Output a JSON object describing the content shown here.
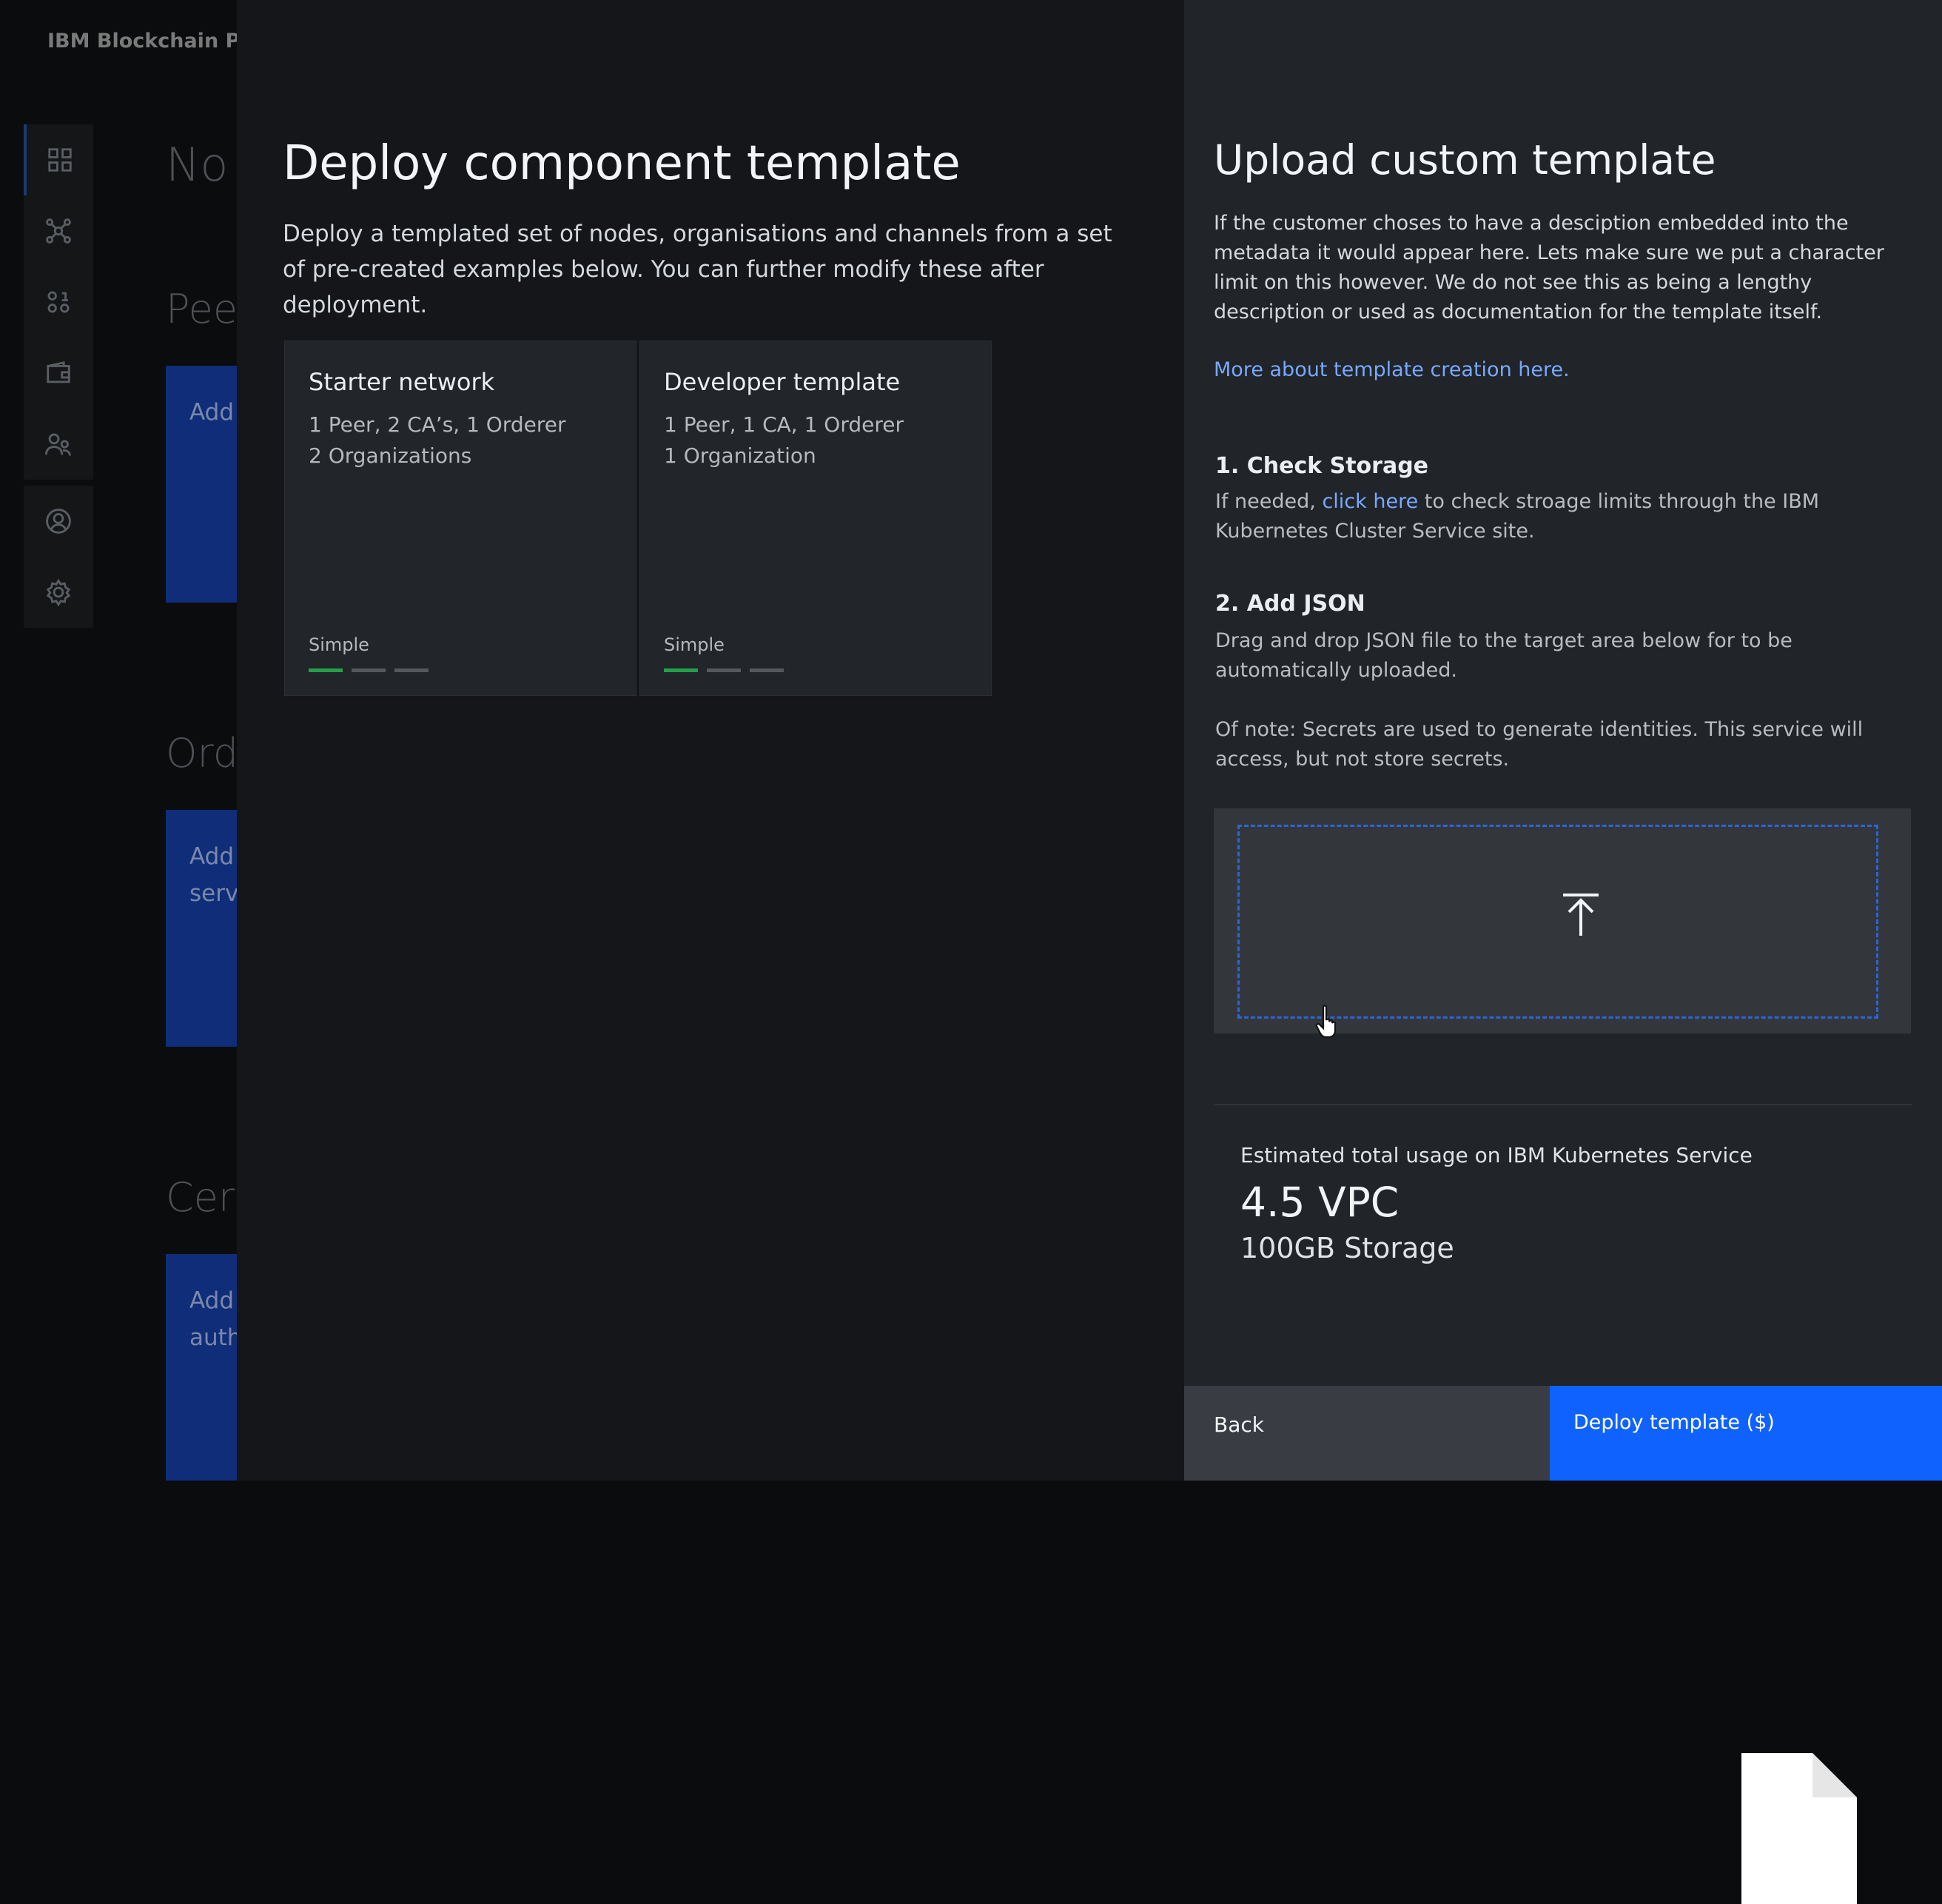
{
  "background": {
    "app_title": "IBM Blockchain Pla",
    "headings": {
      "nodes": "No",
      "peers": "Pee",
      "orderers": "Ord",
      "cas": "Cert"
    },
    "cards": {
      "peers": "Add",
      "orderers": "Add\nservi",
      "cas": "Add\nauth"
    },
    "nav_icons": [
      "grid-icon",
      "network-icon",
      "channels-icon",
      "wallet-icon",
      "organizations-icon",
      "user-profile-icon",
      "settings-icon"
    ]
  },
  "deploy_panel": {
    "title": "Deploy component template",
    "description": "Deploy a templated set of nodes, organisations and channels from a set of pre-created examples below. You can further modify these after deployment.",
    "templates": [
      {
        "name": "Starter network",
        "line1": "1 Peer, 2 CA’s, 1 Orderer",
        "line2": "2 Organizations",
        "complexity": "Simple",
        "level": 1,
        "max_level": 3
      },
      {
        "name": "Developer template",
        "line1": "1 Peer, 1 CA, 1 Orderer",
        "line2": "1 Organization",
        "complexity": "Simple",
        "level": 1,
        "max_level": 3
      }
    ]
  },
  "upload_panel": {
    "title": "Upload custom template",
    "metadata_text": "If the customer choses to have a desciption embedded into the metadata it would appear here. Lets make sure we put a character limit on this however. We do not see this as being a lengthy description or used as documentation for the template itself.",
    "more_link": "More about template creation here.",
    "step1": {
      "title": "1. Check Storage",
      "prefix": "If  needed, ",
      "link": "click here",
      "suffix": " to check stroage limits through the IBM Kubernetes Cluster Service site."
    },
    "step2": {
      "title": "2. Add JSON",
      "text": "Drag and drop JSON file to the target area below for to be automatically uploaded.",
      "note": "Of note: Secrets are used to generate identities. This service will access, but not store secrets."
    },
    "estimate": {
      "label": "Estimated total usage on IBM Kubernetes Service",
      "vpc": "4.5 VPC",
      "storage": "100GB Storage"
    },
    "buttons": {
      "back": "Back",
      "deploy": "Deploy template ($)"
    }
  },
  "colors": {
    "accent": "#0f62fe",
    "link": "#78a9ff",
    "level_on": "#24a148",
    "level_off": "#55595e"
  }
}
